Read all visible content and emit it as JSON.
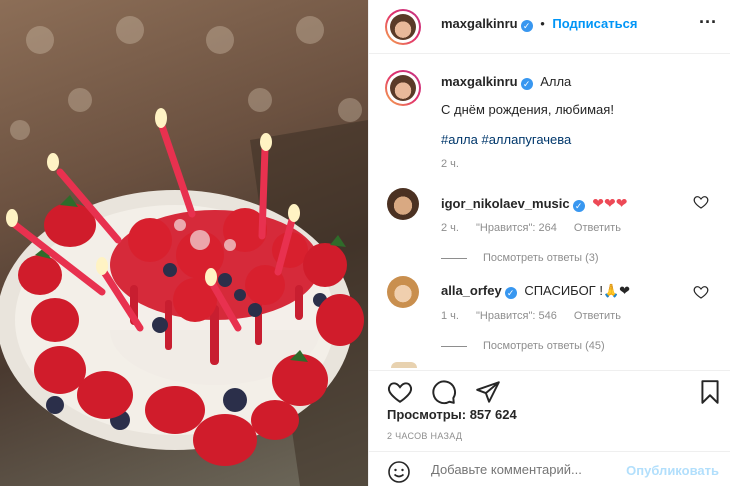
{
  "post": {
    "author": "maxgalkinru",
    "follow_label": "Подписаться",
    "more_label": "···"
  },
  "caption": {
    "author": "maxgalkinru",
    "text": "Алла",
    "line2": "С днём рождения, любимая!",
    "hashtags": "#алла #аллапугачева",
    "time": "2 ч."
  },
  "comments": [
    {
      "author": "igor_nikolaev_music",
      "text": "❤❤❤",
      "time": "2 ч.",
      "likes": "\"Нравится\": 264",
      "reply_label": "Ответить",
      "view_replies": "Посмотреть ответы (3)"
    },
    {
      "author": "alla_orfey",
      "text": "СПАСИБОГ !🙏❤",
      "time": "1 ч.",
      "likes": "\"Нравится\": 546",
      "reply_label": "Ответить",
      "view_replies": "Посмотреть ответы (45)"
    }
  ],
  "stats": {
    "views": "Просмотры: 857 624",
    "ago": "2 ЧАСОВ НАЗАД"
  },
  "add_comment": {
    "placeholder": "Добавьте комментарий...",
    "post_label": "Опубликовать"
  },
  "icons": {
    "like": "heart-icon",
    "comment": "comment-icon",
    "share": "share-icon",
    "save": "bookmark-icon",
    "emoji": "smile-icon",
    "more": "more-icon"
  },
  "colors": {
    "link_blue": "#0095f6",
    "hashtag": "#00376b",
    "heart_red": "#ed4956",
    "verified": "#3897f0"
  }
}
